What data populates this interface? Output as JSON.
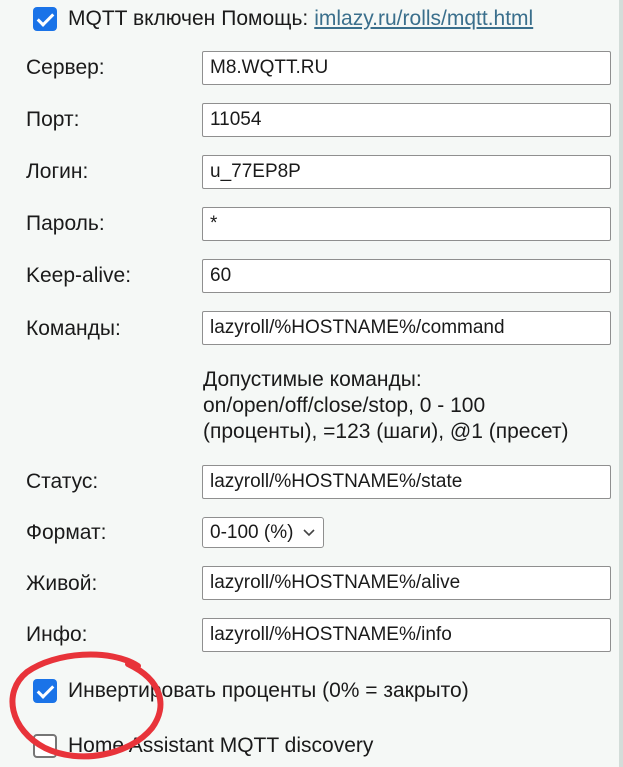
{
  "mqtt": {
    "enabled": true,
    "enabled_label": "MQTT включен",
    "help_label": "Помощь:",
    "help_link": "imlazy.ru/rolls/mqtt.html"
  },
  "fields": {
    "server": {
      "label": "Сервер:",
      "value": "M8.WQTT.RU"
    },
    "port": {
      "label": "Порт:",
      "value": "11054"
    },
    "login": {
      "label": "Логин:",
      "value": "u_77EP8P"
    },
    "password": {
      "label": "Пароль:",
      "value": "*"
    },
    "keepalive": {
      "label": "Keep-alive:",
      "value": "60"
    },
    "commands": {
      "label": "Команды:",
      "value": "lazyroll/%HOSTNAME%/command"
    },
    "status": {
      "label": "Статус:",
      "value": "lazyroll/%HOSTNAME%/state"
    },
    "format": {
      "label": "Формат:",
      "value": "0-100 (%)"
    },
    "alive": {
      "label": "Живой:",
      "value": "lazyroll/%HOSTNAME%/alive"
    },
    "info": {
      "label": "Инфо:",
      "value": "lazyroll/%HOSTNAME%/info"
    }
  },
  "commands_help": "Допустимые команды:\non/open/off/close/stop, 0 - 100\n(проценты), =123 (шаги), @1 (пресет)",
  "options": {
    "invert": {
      "label": "Инвертировать проценты (0% = закрыто)",
      "checked": true
    },
    "ha_discovery": {
      "label": "Home Assistant MQTT discovery",
      "checked": false
    }
  },
  "colors": {
    "checkbox_accent": "#1a73e8",
    "link": "#3a6f8c",
    "annotation_circle": "#e8333a",
    "scrollbar_track": "#d3ddd9"
  },
  "icons": {
    "select_arrow": "chevron-down-icon",
    "checked": "checkmark-icon"
  }
}
